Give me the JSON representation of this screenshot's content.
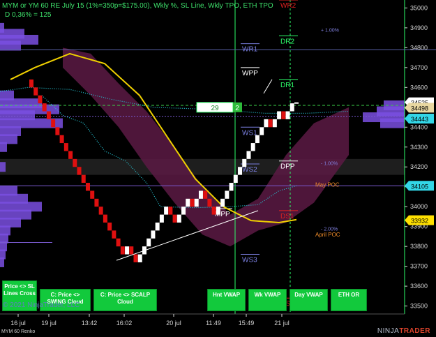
{
  "header": {
    "line1": "MYM or YM 60 RE July 15 (1%=350p=$175.00), Wkly %, SL Line, Wkly TPO, ETH TPO",
    "line2": "D 0,36% = 125"
  },
  "buttons": [
    "Price <> SL Lines Cross",
    "C: Price <> SWING Cloud",
    "C: Price <> SCALP Cloud",
    "Hnt VWAP",
    "Wk VWAP",
    "Day VWAP",
    "ETH OR"
  ],
  "watermark": "© 2021 NinjaTrader, LLC",
  "logo": {
    "left": "NINJA",
    "right": "TRADER"
  },
  "footer": "MYM 60 Renko",
  "colors": {
    "up": "#ffffff",
    "down": "#e01010",
    "neutral": "#8a8a8a",
    "sl_line": "#f0d000",
    "cloud": "#5c1a44",
    "vwap": "#25c8d8",
    "profile": "#7a4fe0",
    "grid": "#2dff6a",
    "axis_text": "#d8d8d8"
  },
  "chart_data": {
    "type": "line",
    "instrument": "MYM 60 Renko",
    "y_axis": {
      "ticks": [
        33500,
        33600,
        33700,
        33800,
        33900,
        34000,
        34100,
        34200,
        34300,
        34400,
        34500,
        34600,
        34700,
        34800,
        34900,
        35000
      ],
      "ylim": [
        33460,
        35040
      ]
    },
    "x_axis": {
      "ticks": [
        "16 jul",
        "19 jul",
        "13:42",
        "16:02",
        "20 jul",
        "11:49",
        "15:49",
        "21 jul"
      ]
    },
    "price_badges": [
      {
        "value": "34525",
        "kind": "last"
      },
      {
        "value": "34498",
        "kind": "level"
      },
      {
        "value": "34443",
        "kind": "vwap"
      },
      {
        "value": "34105",
        "kind": "vwap"
      },
      {
        "value": "33932",
        "kind": "sl"
      }
    ],
    "box_text": {
      "label": "29",
      "count": "2"
    },
    "levels": [
      {
        "name": "WR1",
        "price": 34820
      },
      {
        "name": "DR2",
        "price": 34860
      },
      {
        "name": "WPP",
        "price": 34700
      },
      {
        "name": "DR1",
        "price": 34640
      },
      {
        "name": "WS1",
        "price": 34400
      },
      {
        "name": "DPP",
        "price": 34230
      },
      {
        "name": "WS2",
        "price": 34215
      },
      {
        "name": "MPP",
        "price": 33990
      },
      {
        "name": "DS1",
        "price": 33980
      },
      {
        "name": "WS3",
        "price": 33760
      },
      {
        "name": "DS2",
        "price": 33540
      },
      {
        "name": "WR2",
        "price": 35040
      }
    ],
    "pct_labels": [
      {
        "text": "+ 1.00%",
        "price": 34880
      },
      {
        "text": "- 1.00%",
        "price": 34210
      },
      {
        "text": "- 2.00%",
        "price": 33880
      }
    ],
    "poc_labels": [
      {
        "text": "May POC",
        "price": 34100
      },
      {
        "text": "April POC",
        "price": 33850
      }
    ],
    "candles": [
      {
        "o": 34640,
        "c": 34600
      },
      {
        "o": 34600,
        "c": 34560
      },
      {
        "o": 34560,
        "c": 34520
      },
      {
        "o": 34520,
        "c": 34480
      },
      {
        "o": 34480,
        "c": 34440
      },
      {
        "o": 34440,
        "c": 34400
      },
      {
        "o": 34400,
        "c": 34360
      },
      {
        "o": 34360,
        "c": 34320
      },
      {
        "o": 34320,
        "c": 34280
      },
      {
        "o": 34280,
        "c": 34240
      },
      {
        "o": 34240,
        "c": 34200
      },
      {
        "o": 34200,
        "c": 34160
      },
      {
        "o": 34160,
        "c": 34120
      },
      {
        "o": 34120,
        "c": 34080
      },
      {
        "o": 34080,
        "c": 34040
      },
      {
        "o": 34040,
        "c": 34000
      },
      {
        "o": 34000,
        "c": 33960
      },
      {
        "o": 33960,
        "c": 33920
      },
      {
        "o": 33920,
        "c": 33880
      },
      {
        "o": 33880,
        "c": 33840
      },
      {
        "o": 33840,
        "c": 33800
      },
      {
        "o": 33800,
        "c": 33760
      },
      {
        "o": 33760,
        "c": 33800
      },
      {
        "o": 33800,
        "c": 33760
      },
      {
        "o": 33760,
        "c": 33720
      },
      {
        "o": 33720,
        "c": 33760
      },
      {
        "o": 33760,
        "c": 33800
      },
      {
        "o": 33800,
        "c": 33840
      },
      {
        "o": 33840,
        "c": 33880
      },
      {
        "o": 33880,
        "c": 33920
      },
      {
        "o": 33920,
        "c": 33960
      },
      {
        "o": 33960,
        "c": 34000
      },
      {
        "o": 34000,
        "c": 33960
      },
      {
        "o": 33960,
        "c": 33920
      },
      {
        "o": 33920,
        "c": 33960
      },
      {
        "o": 33960,
        "c": 34000
      },
      {
        "o": 34000,
        "c": 34040
      },
      {
        "o": 34040,
        "c": 34000
      },
      {
        "o": 34000,
        "c": 34040
      },
      {
        "o": 34040,
        "c": 34080
      },
      {
        "o": 34080,
        "c": 34040
      },
      {
        "o": 34040,
        "c": 34000
      },
      {
        "o": 34000,
        "c": 33960
      },
      {
        "o": 33960,
        "c": 34000
      },
      {
        "o": 34000,
        "c": 34040
      },
      {
        "o": 34040,
        "c": 34080
      },
      {
        "o": 34080,
        "c": 34120
      },
      {
        "o": 34120,
        "c": 34160
      },
      {
        "o": 34160,
        "c": 34200
      },
      {
        "o": 34200,
        "c": 34240
      },
      {
        "o": 34240,
        "c": 34280
      },
      {
        "o": 34280,
        "c": 34320
      },
      {
        "o": 34320,
        "c": 34360
      },
      {
        "o": 34360,
        "c": 34400
      },
      {
        "o": 34400,
        "c": 34440
      },
      {
        "o": 34440,
        "c": 34400
      },
      {
        "o": 34400,
        "c": 34440
      },
      {
        "o": 34440,
        "c": 34480
      },
      {
        "o": 34480,
        "c": 34440
      },
      {
        "o": 34440,
        "c": 34480
      },
      {
        "o": 34480,
        "c": 34520
      },
      {
        "o": 34520,
        "c": 34525
      }
    ]
  }
}
